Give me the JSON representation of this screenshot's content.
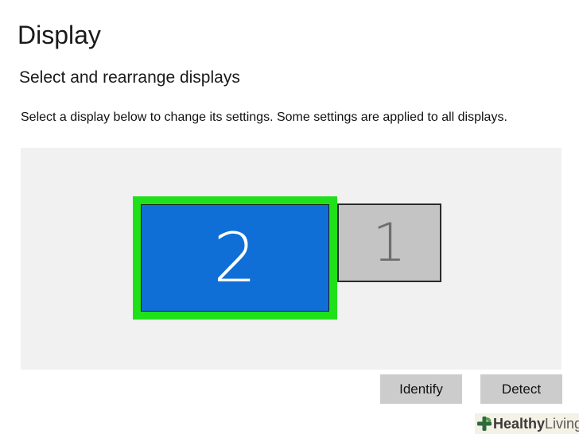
{
  "page": {
    "title": "Display",
    "subtitle": "Select and rearrange displays",
    "description": "Select a display below to change its settings. Some settings are applied to all displays."
  },
  "displays": [
    {
      "number": "2",
      "selected": true,
      "color": "#0f6fd6",
      "highlight_color": "#20e01a"
    },
    {
      "number": "1",
      "selected": false,
      "color": "#c4c4c4"
    }
  ],
  "buttons": {
    "identify_label": "Identify",
    "detect_label": "Detect"
  },
  "watermark": {
    "brand_bold": "Healthy",
    "brand_light": "Living",
    "icon": "plus-leaf-icon",
    "icon_color": "#2e6b3a"
  }
}
